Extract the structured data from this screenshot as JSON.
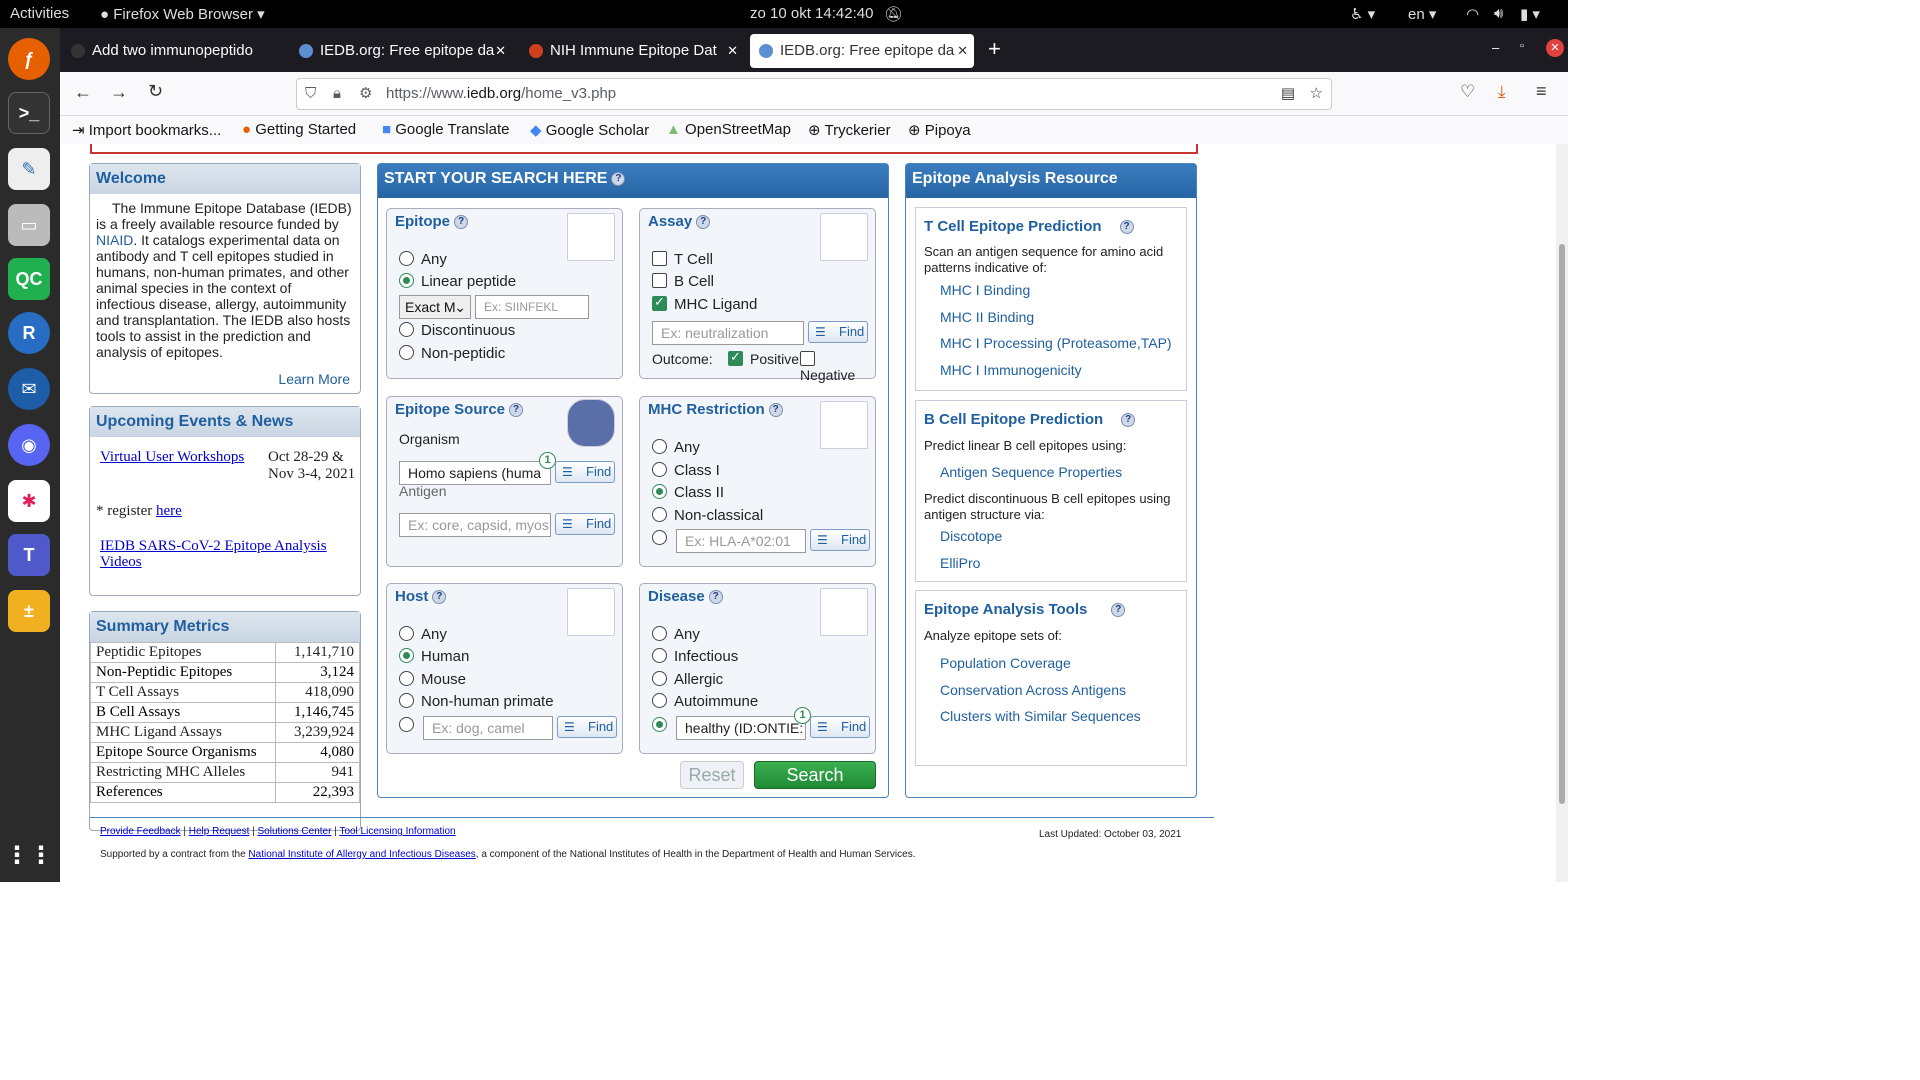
{
  "system": {
    "activities": "Activities",
    "app": "Firefox Web Browser",
    "clock": "zo 10 okt  14:42:40",
    "lang": "en"
  },
  "tabs": [
    {
      "label": "Add two immunopeptido"
    },
    {
      "label": "IEDB.org: Free epitope da"
    },
    {
      "label": "NIH Immune Epitope Dat"
    },
    {
      "label": "IEDB.org: Free epitope da"
    }
  ],
  "url": {
    "pre": "https://www.",
    "domain": "iedb.org",
    "path": "/home_v3.php"
  },
  "bookmarks": [
    "Import bookmarks...",
    "Getting Started",
    "Google Translate",
    "Google Scholar",
    "OpenStreetMap",
    "Tryckerier",
    "Pipoya"
  ],
  "welcome": {
    "title": "Welcome",
    "text_a": "The Immune Epitope Database (IEDB) is a freely available resource funded by ",
    "niaid": "NIAID",
    "text_b": ". It catalogs experimental data on antibody and T cell epitopes studied in humans, non-human primates, and other animal species in the context of infectious disease, allergy, autoimmunity and transplantation. The IEDB also hosts tools to assist in the prediction and analysis of epitopes.",
    "learn": "Learn More"
  },
  "events": {
    "title": "Upcoming Events & News",
    "workshop": "Virtual User Workshops",
    "dates": "Oct 28-29 & Nov 3-4, 2021",
    "register": "* register ",
    "here": "here",
    "videos": "IEDB SARS-CoV-2 Epitope Analysis Videos"
  },
  "metrics": {
    "title": "Summary Metrics",
    "rows": [
      [
        "Peptidic Epitopes",
        "1,141,710"
      ],
      [
        "Non-Peptidic Epitopes",
        "3,124"
      ],
      [
        "T Cell Assays",
        "418,090"
      ],
      [
        "B Cell Assays",
        "1,146,745"
      ],
      [
        "MHC Ligand Assays",
        "3,239,924"
      ],
      [
        "Epitope Source Organisms",
        "4,080"
      ],
      [
        "Restricting MHC Alleles",
        "941"
      ],
      [
        "References",
        "22,393"
      ]
    ]
  },
  "search": {
    "title": "START YOUR SEARCH HERE",
    "find": "Find",
    "reset": "Reset",
    "search": "Search",
    "epitope": {
      "title": "Epitope",
      "any": "Any",
      "linear": "Linear peptide",
      "match": "Exact M",
      "placeholder": "Ex: SIINFEKL",
      "disc": "Discontinuous",
      "nonpep": "Non-peptidic"
    },
    "assay": {
      "title": "Assay",
      "t": "T Cell",
      "b": "B Cell",
      "mhc": "MHC Ligand",
      "placeholder": "Ex: neutralization",
      "outcome": "Outcome:",
      "pos": "Positive",
      "neg": "Negative"
    },
    "source": {
      "title": "Epitope Source",
      "organism": "Organism",
      "org_value": "Homo sapiens (huma",
      "antigen": "Antigen",
      "ant_placeholder": "Ex: core, capsid, myos",
      "badge": "1"
    },
    "mhc": {
      "title": "MHC Restriction",
      "any": "Any",
      "c1": "Class I",
      "c2": "Class II",
      "nc": "Non-classical",
      "placeholder": "Ex: HLA-A*02:01"
    },
    "host": {
      "title": "Host",
      "any": "Any",
      "human": "Human",
      "mouse": "Mouse",
      "nhp": "Non-human primate",
      "placeholder": "Ex: dog, camel"
    },
    "disease": {
      "title": "Disease",
      "any": "Any",
      "inf": "Infectious",
      "all": "Allergic",
      "auto": "Autoimmune",
      "value": "healthy (ID:ONTIE:",
      "badge": "1"
    }
  },
  "analysis": {
    "title": "Epitope Analysis Resource",
    "tcell": {
      "title": "T Cell Epitope Prediction",
      "desc": "Scan an antigen sequence for amino acid patterns indicative of:",
      "links": [
        "MHC I Binding",
        "MHC II Binding",
        "MHC I Processing (Proteasome,TAP)",
        "MHC I Immunogenicity"
      ]
    },
    "bcell": {
      "title": "B Cell Epitope Prediction",
      "desc1": "Predict linear B cell epitopes using:",
      "link1": "Antigen Sequence Properties",
      "desc2": "Predict discontinuous B cell epitopes using antigen structure via:",
      "links": [
        "Discotope",
        "ElliPro"
      ]
    },
    "tools": {
      "title": "Epitope Analysis Tools",
      "desc": "Analyze epitope sets of:",
      "links": [
        "Population Coverage",
        "Conservation Across Antigens",
        "Clusters with Similar Sequences"
      ]
    }
  },
  "footer": {
    "links": [
      "Provide Feedback",
      "Help Request",
      "Solutions Center",
      "Tool Licensing Information"
    ],
    "updated": "Last Updated: October 03, 2021",
    "supported_a": "Supported by a contract from the ",
    "niaid_full": "National Institute of Allergy and Infectious Diseases",
    "supported_b": ", a component of the National Institutes of Health in the Department of Health and Human Services."
  }
}
